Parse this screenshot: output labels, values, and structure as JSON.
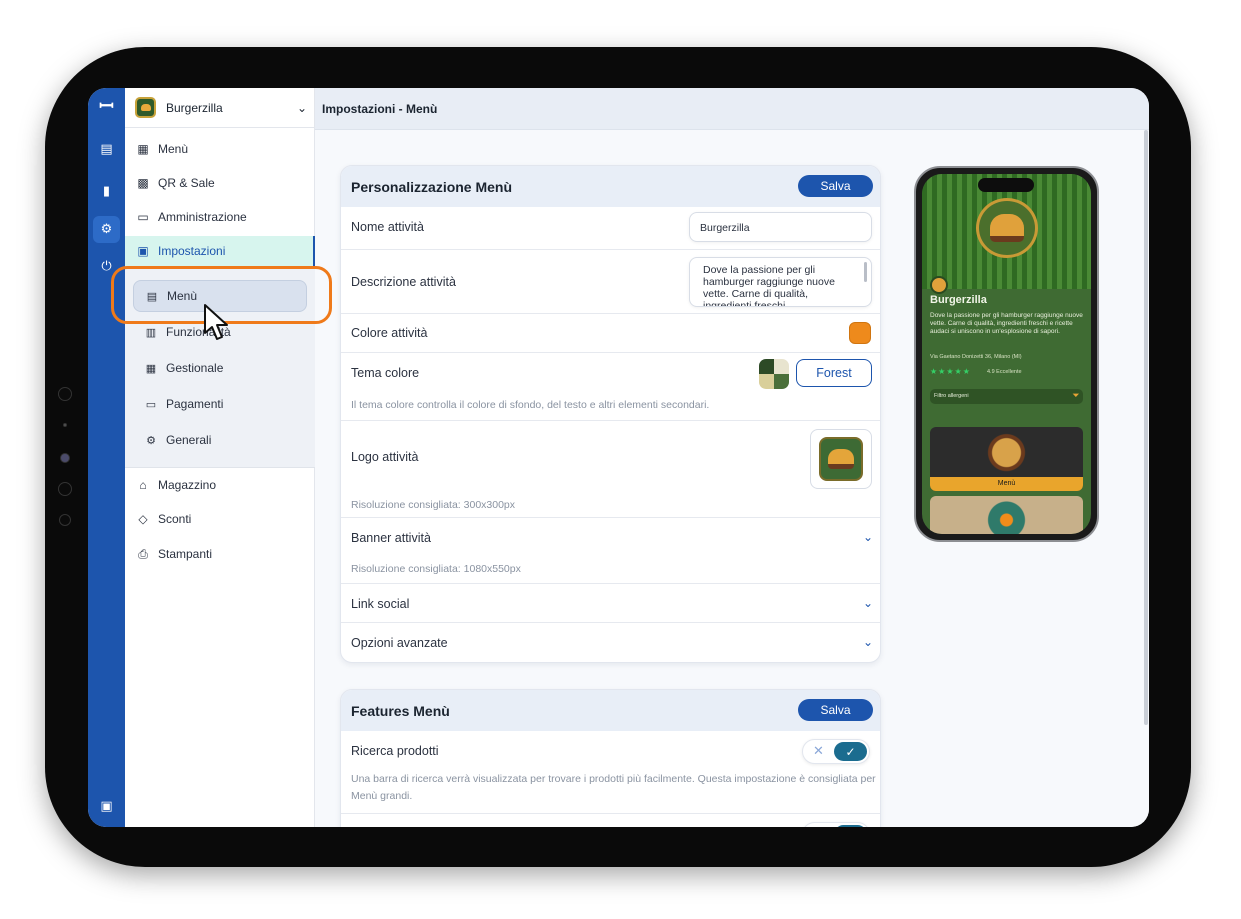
{
  "app": {
    "brand_name": "Burgerzilla",
    "page_title": "Impostazioni - Menù"
  },
  "rail": {
    "icons": [
      "logo-icon",
      "receipt-icon",
      "chart-icon",
      "settings-icon",
      "plug-icon",
      "monitor-icon"
    ]
  },
  "sidebar": {
    "items": [
      {
        "label": "Menù",
        "icon": "menu-book-icon"
      },
      {
        "label": "QR & Sale",
        "icon": "qr-icon"
      },
      {
        "label": "Amministrazione",
        "icon": "admin-icon"
      },
      {
        "label": "Impostazioni",
        "icon": "settings-store-icon"
      }
    ],
    "sub_items": [
      {
        "label": "Menù",
        "icon": "menu-store-icon"
      },
      {
        "label": "Funzionalità",
        "icon": "features-icon"
      },
      {
        "label": "Gestionale",
        "icon": "management-icon"
      },
      {
        "label": "Pagamenti",
        "icon": "card-icon"
      },
      {
        "label": "Generali",
        "icon": "gear-icon"
      }
    ],
    "bottom_items": [
      {
        "label": "Magazzino",
        "icon": "warehouse-icon"
      },
      {
        "label": "Sconti",
        "icon": "tag-icon"
      },
      {
        "label": "Stampanti",
        "icon": "printer-icon"
      }
    ]
  },
  "personalization": {
    "title": "Personalizzazione Menù",
    "save_label": "Salva",
    "nome_label": "Nome attività",
    "nome_value": "Burgerzilla",
    "descrizione_label": "Descrizione attività",
    "descrizione_value": "Dove la passione per gli hamburger raggiunge nuove vette. Carne di qualità, ingredienti freschi",
    "colore_label": "Colore attività",
    "colore_value": "#ee8a1c",
    "tema_label": "Tema colore",
    "tema_button": "Forest",
    "tema_hint": "Il tema colore controlla il colore di sfondo, del testo e altri elementi secondari.",
    "logo_label": "Logo attività",
    "logo_hint": "Risoluzione consigliata: 300x300px",
    "banner_label": "Banner attività",
    "banner_hint": "Risoluzione consigliata: 1080x550px",
    "social_label": "Link social",
    "advanced_label": "Opzioni avanzate"
  },
  "features": {
    "title": "Features Menù",
    "save_label": "Salva",
    "search_label": "Ricerca prodotti",
    "search_hint": "Una barra di ricerca verrà visualizzata per trovare i prodotti più facilmente. Questa impostazione è consigliata per Menù grandi.",
    "search_enabled": true
  },
  "preview": {
    "title": "Burgerzilla",
    "description": "Dove la passione per gli hamburger raggiunge nuove vette. Carne di qualità, ingredienti freschi e ricette audaci si uniscono in un'esplosione di sapori.",
    "address": "Via Gaetano Donizetti 36, Milano (MI)",
    "rating": "4.9 Eccellente",
    "filter_label": "Filtro allergeni",
    "category_label": "Menù"
  },
  "colors": {
    "accent": "#1d55ad",
    "highlight": "#ef7a1a",
    "brand_orange": "#ee8a1c",
    "forest_green": "#3f6b33"
  }
}
